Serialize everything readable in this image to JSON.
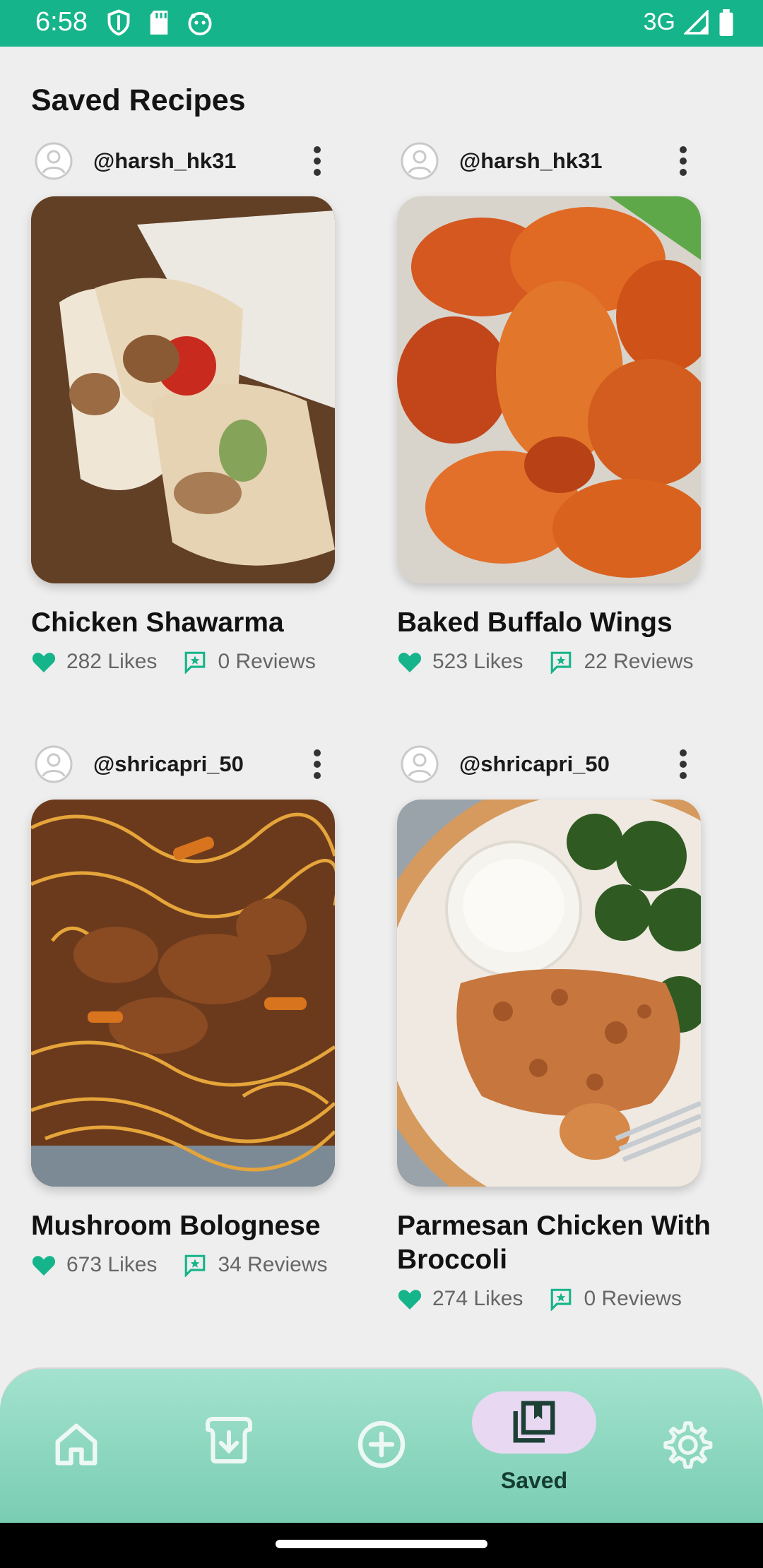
{
  "status_bar": {
    "time": "6:58",
    "network": "3G"
  },
  "page_title": "Saved Recipes",
  "recipes": [
    {
      "user": "@harsh_hk31",
      "title": "Chicken Shawarma",
      "likes": "282 Likes",
      "reviews": "0 Reviews",
      "image": "chicken-shawarma-photo"
    },
    {
      "user": "@harsh_hk31",
      "title": "Baked Buffalo Wings",
      "likes": "523 Likes",
      "reviews": "22 Reviews",
      "image": "buffalo-wings-photo"
    },
    {
      "user": "@shricapri_50",
      "title": "Mushroom Bolognese",
      "likes": "673 Likes",
      "reviews": "34 Reviews",
      "image": "mushroom-bolognese-photo"
    },
    {
      "user": "@shricapri_50",
      "title": "Parmesan Chicken With Broccoli",
      "likes": "274 Likes",
      "reviews": "0 Reviews",
      "image": "parmesan-chicken-photo"
    }
  ],
  "bottom_nav": {
    "items": [
      {
        "icon": "home-icon"
      },
      {
        "icon": "download-box-icon"
      },
      {
        "icon": "add-circle-icon"
      },
      {
        "icon": "saved-bookmarks-icon",
        "label": "Saved",
        "active": true
      },
      {
        "icon": "gear-icon"
      }
    ]
  },
  "colors": {
    "accent": "#16b48a",
    "nav_active_pill": "#e8d8f2",
    "background": "#eeeeee"
  }
}
